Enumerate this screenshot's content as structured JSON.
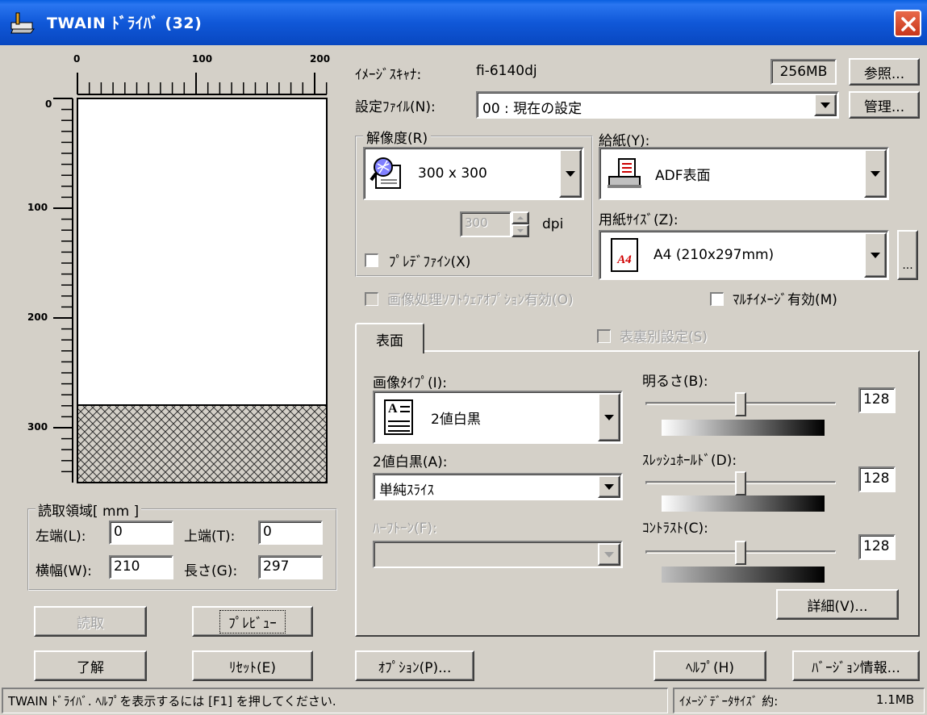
{
  "window": {
    "title": "TWAIN ﾄﾞﾗｲﾊﾞ (32)"
  },
  "ruler": {
    "h_ticks": [
      "0",
      "100",
      "200"
    ],
    "v_ticks": [
      "0",
      "100",
      "200",
      "300"
    ]
  },
  "scan_area": {
    "group_label": "読取領域[ mm ]",
    "left_label": "左端(L):",
    "left_value": "0",
    "top_label": "上端(T):",
    "top_value": "0",
    "width_label": "横幅(W):",
    "width_value": "210",
    "length_label": "長さ(G):",
    "length_value": "297"
  },
  "left_buttons": {
    "scan": "読取",
    "preview": "ﾌﾟﾚﾋﾞｭｰ",
    "ok": "了解",
    "reset": "ﾘｾｯﾄ(E)"
  },
  "scanner": {
    "label": "ｲﾒｰｼﾞｽｷｬﾅ:",
    "model": "fi-6140dj",
    "memory": "256MB",
    "browse_button": "参照..."
  },
  "settings_file": {
    "label": "設定ﾌｧｲﾙ(N):",
    "value": "00 : 現在の設定",
    "manage_button": "管理..."
  },
  "resolution": {
    "group_label": "解像度(R)",
    "value": "300 x 300",
    "dpi_value": "300",
    "dpi_unit": "dpi",
    "prefine_label": "ﾌﾟﾚﾃﾞﾌｧｲﾝ(X)"
  },
  "paper_feed": {
    "label": "給紙(Y):",
    "value": "ADF表面"
  },
  "paper_size": {
    "label": "用紙ｻｲｽﾞ(Z):",
    "value": "A4 (210x297mm)",
    "icon_text": "A4",
    "more_button": "..."
  },
  "options": {
    "software_option": "画像処理ｿﾌﾄｳｪｱｵﾌﾟｼｮﾝ有効(O)",
    "multi_image": "ﾏﾙﾁｲﾒｰｼﾞ有効(M)",
    "front_back": "表裏別設定(S)"
  },
  "tab": {
    "label": "表面"
  },
  "image_type": {
    "label": "画像ﾀｲﾌﾟ(I):",
    "value": "2値白黒"
  },
  "binary": {
    "label": "2値白黒(A):",
    "value": "単純ｽﾗｲｽ"
  },
  "halftone": {
    "label": "ﾊｰﾌﾄｰﾝ(F):",
    "value": ""
  },
  "brightness": {
    "label": "明るさ(B):",
    "value": "128",
    "level": 0.5
  },
  "threshold": {
    "label": "ｽﾚｯｼｭﾎｰﾙﾄﾞ(D):",
    "value": "128",
    "level": 0.5
  },
  "contrast": {
    "label": "ｺﾝﾄﾗｽﾄ(C):",
    "value": "128",
    "level": 0.5
  },
  "detail_button": "詳細(V)...",
  "bottom_buttons": {
    "options": "ｵﾌﾟｼｮﾝ(P)...",
    "help": "ﾍﾙﾌﾟ(H)",
    "version": "ﾊﾞｰｼﾞｮﾝ情報..."
  },
  "statusbar": {
    "message": "TWAIN ﾄﾞﾗｲﾊﾞ. ﾍﾙﾌﾟを表示するには [F1] を押してください.",
    "size_label": "ｲﾒｰｼﾞﾃﾞｰﾀｻｲｽﾞ 約:",
    "size_value": "1.1MB"
  },
  "colors": {
    "titlebar": "#0a5fe0",
    "face": "#d4d0c8",
    "close": "#c8361a"
  }
}
